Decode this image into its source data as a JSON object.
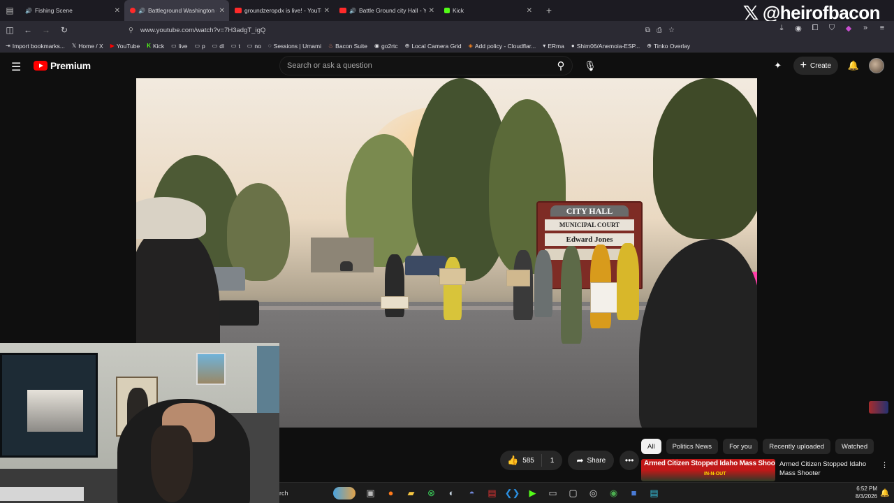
{
  "tabs": [
    {
      "title": "Fishing Scene",
      "active": false,
      "audio": true
    },
    {
      "title": "Battleground Washington o",
      "active": true,
      "audio": true
    },
    {
      "title": "groundzeropdx is live! - YouTub",
      "active": false,
      "audio": false
    },
    {
      "title": "Battle Ground city Hall - Yo",
      "active": false,
      "audio": true
    },
    {
      "title": "Kick",
      "active": false,
      "audio": false
    }
  ],
  "brand_overlay": {
    "handle": "@heirofbacon"
  },
  "address_bar": {
    "url": "www.youtube.com/watch?v=7H3adgT_igQ"
  },
  "bookmarks": [
    "Import bookmarks...",
    "Home / X",
    "YouTube",
    "Kick",
    "live",
    "p",
    "dl",
    "t",
    "no",
    "Sessions | Umami",
    "Bacon Suite",
    "go2rtc",
    "Local Camera Grid",
    "Add policy - Cloudflar...",
    "ERma",
    "Shim06/Anemoia-ESP...",
    "Tinko Overlay"
  ],
  "youtube": {
    "logo_text": "Premium",
    "search_placeholder": "Search or ask a question",
    "create_label": "Create"
  },
  "video_scene": {
    "sign_top": "CITY HALL",
    "sign_middle": "MUNICIPAL COURT",
    "sign_lower": "Edward Jones"
  },
  "actions": {
    "likes": "585",
    "dislikes": "1",
    "share_label": "Share"
  },
  "chips": [
    "All",
    "Politics News",
    "For you",
    "Recently uploaded",
    "Watched"
  ],
  "recommendation": {
    "thumb_title": "Armed Citizen Stopped Idaho Mass Shooter",
    "thumb_sub": "IN-N-OUT",
    "title": "Armed Citizen Stopped Idaho Mass Shooter"
  },
  "taskbar": {
    "search_text": "rch",
    "time": "6:52 PM",
    "date": "8/3/2026"
  },
  "colors": {
    "yt_red": "#ff0000",
    "bg": "#0f0f0f",
    "chip_active": "#f1f1f1"
  }
}
